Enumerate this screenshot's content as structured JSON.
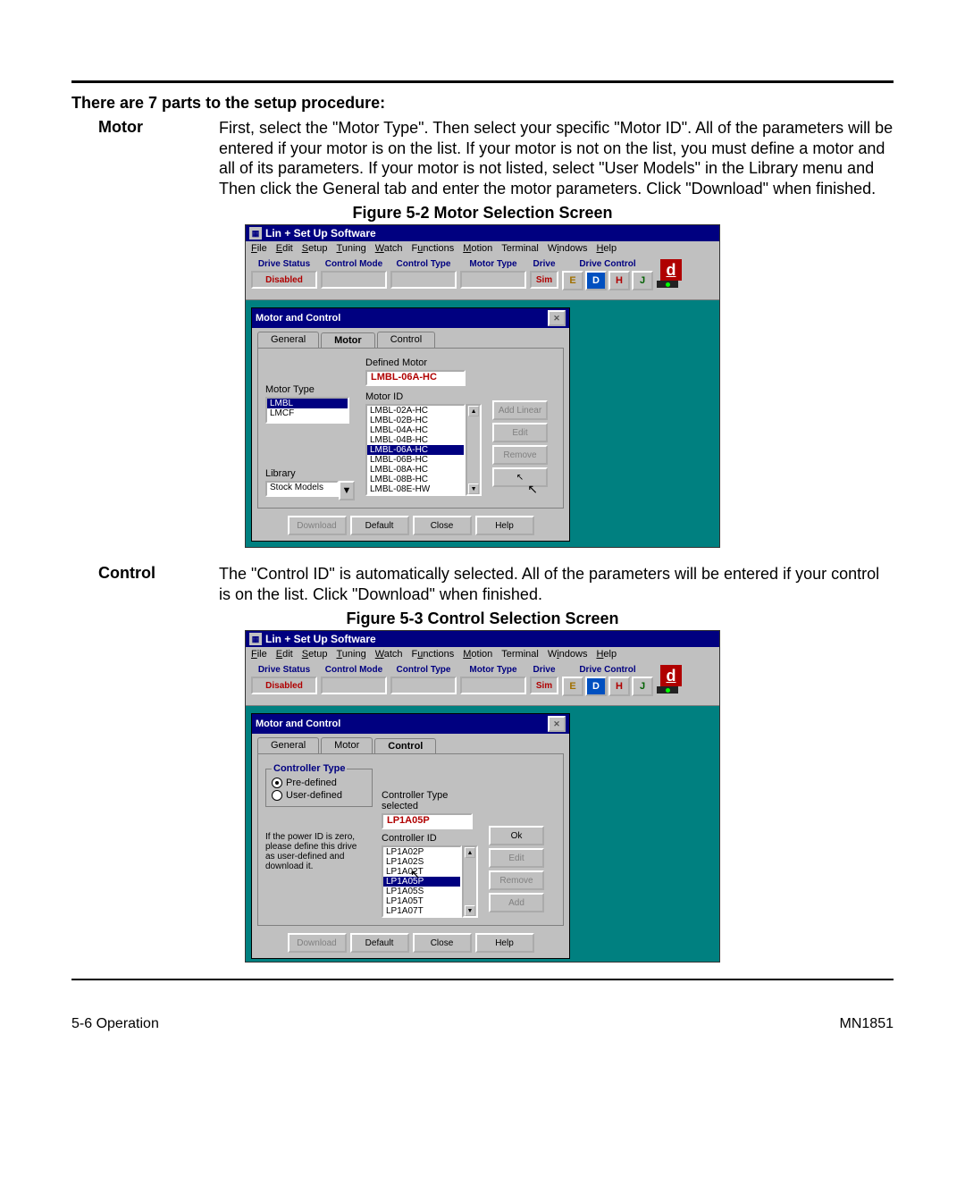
{
  "intro": {
    "heading": "There are 7 parts to the setup procedure:",
    "motor_label": "Motor",
    "motor_text": "First, select the \"Motor Type\".  Then select your specific \"Motor ID\".    All of the parameters will be entered if your motor is on the list.  If your motor is not on the list,  you must define a motor and all of its parameters.  If your motor is not listed, select \"User Models\" in the Library menu and Then click the General tab and enter the motor parameters.  Click \"Download\" when finished.",
    "control_label": "Control",
    "control_text": "The \"Control ID\" is automatically selected.   All of the parameters will be entered if your control is on the list.    Click \"Download\" when finished."
  },
  "figure52_caption": "Figure 5-2  Motor Selection Screen",
  "figure53_caption": "Figure 5-3  Control Selection Screen",
  "app_title": "Lin + Set Up Software",
  "menus": [
    "File",
    "Edit",
    "Setup",
    "Tuning",
    "Watch",
    "Functions",
    "Motion",
    "Terminal",
    "Windows",
    "Help"
  ],
  "toolbar": {
    "drive_status_label": "Drive Status",
    "drive_status_value": "Disabled",
    "control_mode_label": "Control Mode",
    "control_type_label": "Control Type",
    "motor_type_label": "Motor Type",
    "drive_label": "Drive",
    "drive_value": "Sim",
    "drive_control_label": "Drive Control",
    "dc_buttons": [
      "E",
      "D",
      "H",
      "J"
    ],
    "brand_letter": "d"
  },
  "dialog": {
    "title": "Motor and Control",
    "tabs_motor": [
      "General",
      "Motor",
      "Control"
    ],
    "tabs_control": [
      "General",
      "Motor",
      "Control"
    ],
    "motor": {
      "motor_type_label": "Motor Type",
      "motor_types": [
        "LMBL",
        "LMCF"
      ],
      "motor_type_selected": "LMBL",
      "library_label": "Library",
      "library_value": "Stock Models",
      "defined_motor_label": "Defined Motor",
      "defined_motor_value": "LMBL-06A-HC",
      "motor_id_label": "Motor ID",
      "motor_ids": [
        "LMBL-02A-HC",
        "LMBL-02B-HC",
        "LMBL-04A-HC",
        "LMBL-04B-HC",
        "LMBL-06A-HC",
        "LMBL-06B-HC",
        "LMBL-08A-HC",
        "LMBL-08B-HC",
        "LMBL-08E-HW"
      ],
      "motor_id_selected": "LMBL-06A-HC",
      "buttons": {
        "add": "Add Linear",
        "edit": "Edit",
        "remove": "Remove"
      }
    },
    "control": {
      "group_label": "Controller Type",
      "radio_predefined": "Pre-defined",
      "radio_userdefined": "User-defined",
      "hint": "If the power ID is zero, please define this drive as user-defined and download it.",
      "ctype_sel_label": "Controller Type selected",
      "ctype_sel_value": "LP1A05P",
      "cid_label": "Controller ID",
      "cids": [
        "LP1A02P",
        "LP1A02S",
        "LP1A02T",
        "LP1A05P",
        "LP1A05S",
        "LP1A05T",
        "LP1A07T"
      ],
      "cid_selected": "LP1A05P",
      "buttons": {
        "ok": "Ok",
        "edit": "Edit",
        "remove": "Remove",
        "add": "Add"
      }
    },
    "footer": {
      "download": "Download",
      "default": "Default",
      "close": "Close",
      "help": "Help"
    }
  },
  "page_footer": {
    "left": "5-6 Operation",
    "right": "MN1851"
  }
}
